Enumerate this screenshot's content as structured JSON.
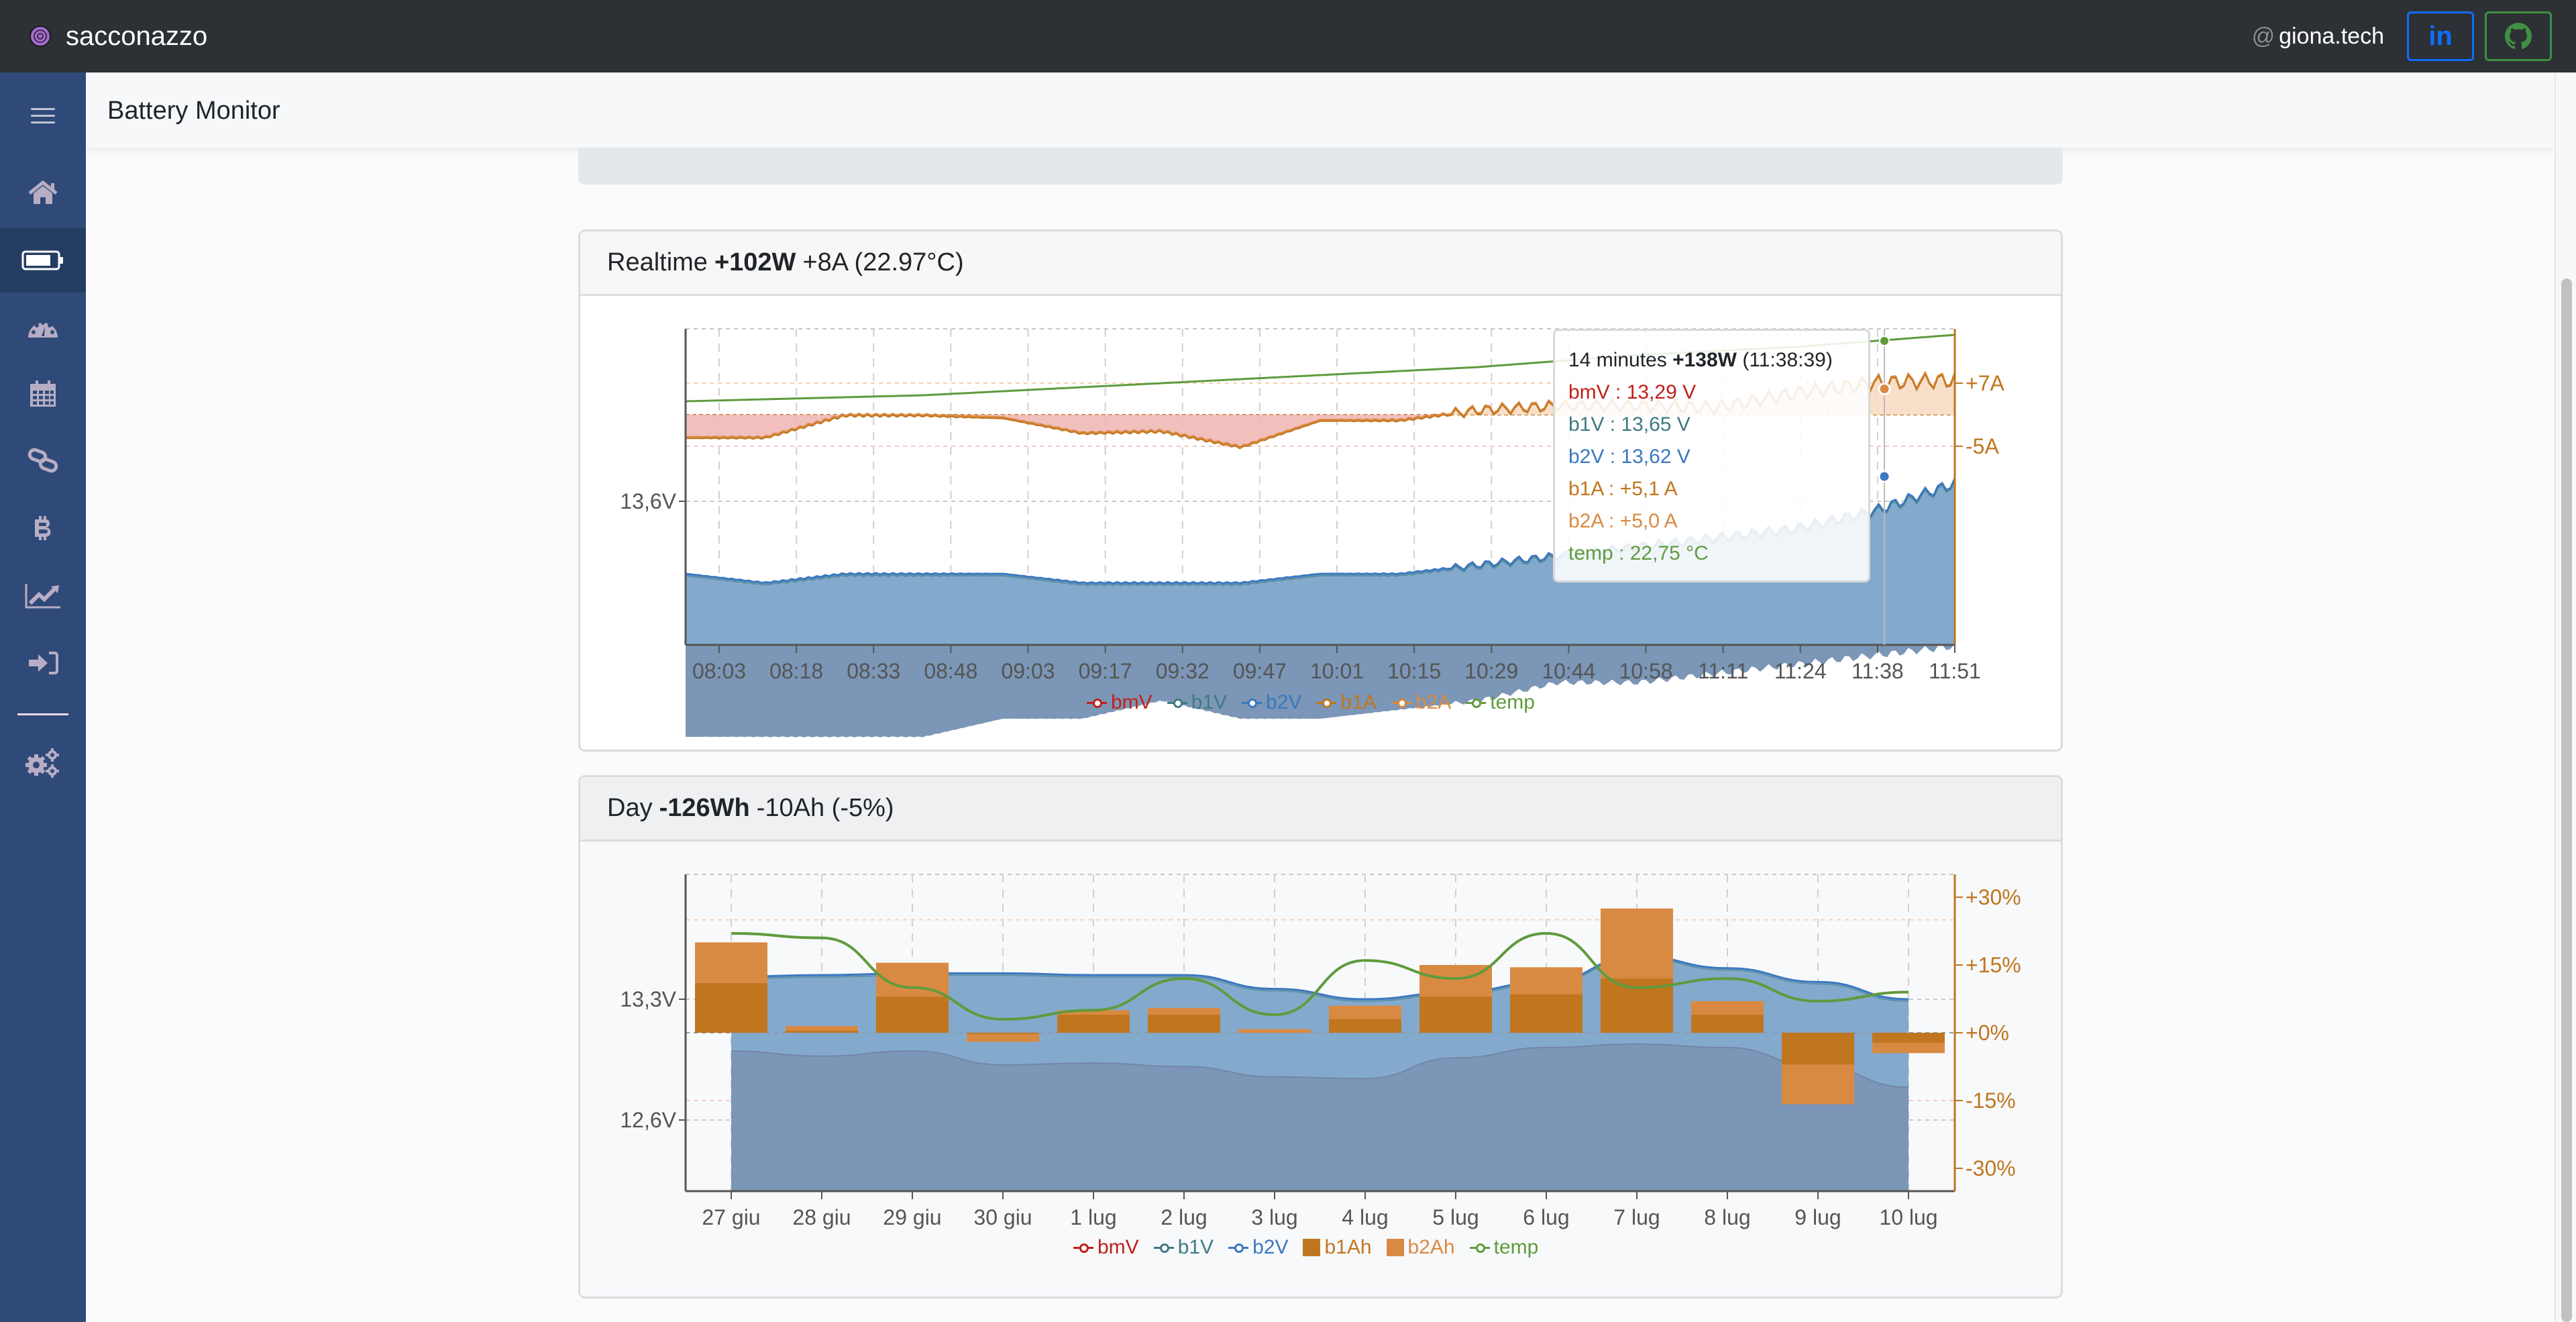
{
  "navbar": {
    "brand": "sacconazzo",
    "at_symbol": "@",
    "user": "giona.tech",
    "linkedin_label": "in",
    "github_icon": "github-icon"
  },
  "sidebar": {
    "items": [
      {
        "icon": "menu-icon",
        "label": "Menu"
      },
      {
        "icon": "home-icon",
        "label": "Home"
      },
      {
        "icon": "battery-icon",
        "label": "Battery Monitor",
        "active": true
      },
      {
        "icon": "dashboard-gauge-icon",
        "label": "Dashboard"
      },
      {
        "icon": "calendar-icon",
        "label": "Calendar"
      },
      {
        "icon": "link-icon",
        "label": "Links"
      },
      {
        "icon": "bitcoin-icon",
        "label": "Bitcoin"
      },
      {
        "icon": "chart-line-icon",
        "label": "Charts"
      },
      {
        "icon": "sign-in-icon",
        "label": "Login"
      },
      {
        "icon": "settings-cogs-icon",
        "label": "Settings"
      }
    ]
  },
  "page": {
    "title": "Battery Monitor"
  },
  "realtime": {
    "header_prefix": "Realtime",
    "header_power": "+102W",
    "header_rest": "+8A (22.97°C)",
    "tooltip": {
      "duration": "14 minutes",
      "power": "+138W",
      "time": "(11:38:39)",
      "rows": [
        {
          "label": "bmV : 13,29 V",
          "color": "#c0201a"
        },
        {
          "label": "b1V : 13,65 V",
          "color": "#3e7a80"
        },
        {
          "label": "b2V : 13,62 V",
          "color": "#3a78c0"
        },
        {
          "label": "b1A : +5,1 A",
          "color": "#c0761f"
        },
        {
          "label": "b2A : +5,0 A",
          "color": "#d98a42"
        },
        {
          "label": "temp : 22,75 °C",
          "color": "#5f9b3d"
        }
      ]
    }
  },
  "day": {
    "header_prefix": "Day",
    "header_energy": "-126Wh",
    "header_rest": "-10Ah (-5%)"
  },
  "colors": {
    "bmV": "#c0201a",
    "b1V": "#3e7a80",
    "b2V": "#3a78c0",
    "b1A": "#c0761f",
    "b2A": "#d98a42",
    "temp": "#5f9b3d",
    "axis_right": "#c0761f"
  },
  "chart_data": [
    {
      "type": "line",
      "title": "Realtime",
      "x_ticks": [
        "08:03",
        "08:18",
        "08:33",
        "08:48",
        "09:03",
        "09:17",
        "09:32",
        "09:47",
        "10:01",
        "10:15",
        "10:29",
        "10:44",
        "10:58",
        "11:11",
        "11:24",
        "11:38",
        "11:51"
      ],
      "y_left_ticks": [
        "13,6V"
      ],
      "y_right_ticks": [
        "+7A",
        "-5A"
      ],
      "legend": [
        "bmV",
        "b1V",
        "b2V",
        "b1A",
        "b2A",
        "temp"
      ],
      "legend_position": "bottom-center",
      "grid": true,
      "series": [
        {
          "name": "b1V",
          "values": [
            13.52,
            13.51,
            13.52,
            13.52,
            13.52,
            13.51,
            13.51,
            13.51,
            13.52,
            13.52,
            13.53,
            13.54,
            13.55,
            13.56,
            13.57,
            13.59,
            13.62
          ]
        },
        {
          "name": "b2V",
          "values": [
            13.5,
            13.51,
            13.52,
            13.52,
            13.52,
            13.51,
            13.5,
            13.51,
            13.52,
            13.52,
            13.53,
            13.54,
            13.55,
            13.56,
            13.57,
            13.59,
            13.61
          ]
        },
        {
          "name": "bmV",
          "values": [
            13.34,
            13.34,
            13.34,
            13.34,
            13.36,
            13.36,
            13.38,
            13.36,
            13.36,
            13.37,
            13.38,
            13.4,
            13.4,
            13.41,
            13.42,
            13.43,
            13.44
          ]
        },
        {
          "name": "b1A",
          "values": [
            -3.5,
            -3.5,
            0,
            0,
            -0.4,
            -2.8,
            -2.5,
            -5,
            -0.8,
            -0.8,
            0.8,
            1.5,
            1.5,
            1.2,
            3.5,
            5.1,
            5.5
          ]
        },
        {
          "name": "b2A",
          "values": [
            -3.4,
            -3.4,
            0,
            0,
            -0.4,
            -2.7,
            -2.4,
            -4.9,
            -0.8,
            -0.8,
            0.8,
            1.4,
            1.4,
            1.1,
            3.4,
            5.0,
            5.4
          ]
        },
        {
          "name": "temp",
          "values": [
            22.45,
            22.46,
            22.47,
            22.48,
            22.5,
            22.52,
            22.54,
            22.56,
            22.58,
            22.6,
            22.62,
            22.65,
            22.68,
            22.7,
            22.72,
            22.75,
            22.78
          ]
        }
      ],
      "hover": {
        "x": "11:38:39"
      }
    },
    {
      "type": "bar",
      "title": "Day",
      "categories": [
        "27 giu",
        "28 giu",
        "29 giu",
        "30 giu",
        "1 lug",
        "2 lug",
        "3 lug",
        "4 lug",
        "5 lug",
        "6 lug",
        "7 lug",
        "8 lug",
        "9 lug",
        "10 lug"
      ],
      "y_left_ticks": [
        "13,3V",
        "12,6V"
      ],
      "y_right_ticks": [
        "+30%",
        "+15%",
        "+0%",
        "-15%",
        "-30%"
      ],
      "y_right_range": [
        -35,
        35
      ],
      "legend": [
        "bmV",
        "b1V",
        "b2V",
        "b1Ah",
        "b2Ah",
        "temp"
      ],
      "legend_position": "bottom-center",
      "grid": true,
      "series": [
        {
          "name": "b1Ah",
          "unit": "%",
          "values": [
            11,
            0.5,
            8,
            -0.3,
            4,
            4,
            0,
            3,
            8,
            8.5,
            12,
            4,
            -7,
            -2.2
          ]
        },
        {
          "name": "b2Ah",
          "unit": "%",
          "values": [
            20,
            1.5,
            15.5,
            -2,
            5,
            5.5,
            0.8,
            6,
            15,
            14.5,
            27.5,
            7,
            -15.8,
            -4.5
          ]
        },
        {
          "name": "b1V",
          "unit": "V",
          "values": [
            13.43,
            13.44,
            13.45,
            13.45,
            13.44,
            13.44,
            13.36,
            13.3,
            13.34,
            13.4,
            13.55,
            13.48,
            13.4,
            13.3
          ]
        },
        {
          "name": "b2V",
          "unit": "V",
          "values": [
            13.42,
            13.43,
            13.44,
            13.44,
            13.43,
            13.43,
            13.35,
            13.29,
            13.33,
            13.39,
            13.54,
            13.47,
            13.39,
            13.29
          ]
        },
        {
          "name": "bmV",
          "unit": "V",
          "values": [
            13.0,
            12.97,
            13.0,
            12.92,
            12.93,
            12.91,
            12.85,
            12.84,
            12.96,
            13.02,
            13.04,
            13.02,
            12.91,
            12.79
          ]
        },
        {
          "name": "temp",
          "unit": "%-axis",
          "values": [
            22,
            21,
            10,
            3,
            5,
            12,
            4,
            16,
            12,
            22,
            10,
            12,
            7,
            9
          ]
        }
      ]
    }
  ]
}
